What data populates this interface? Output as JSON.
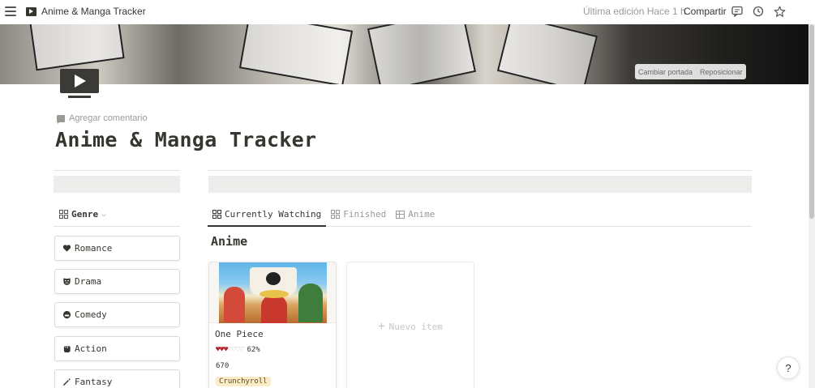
{
  "topbar": {
    "breadcrumb": "Anime & Manga Tracker",
    "last_edited": "Última edición Hace 1 h",
    "share_label": "Compartir",
    "icons": [
      "menu-icon",
      "comment-icon",
      "history-icon",
      "star-icon"
    ]
  },
  "cover": {
    "change_cover": "Cambiar portada",
    "reposition": "Reposicionar"
  },
  "page": {
    "icon": "tv-icon",
    "add_comment": "Agregar comentario",
    "title": "Anime & Manga Tracker"
  },
  "genre_filter": {
    "label": "Genre",
    "items": [
      {
        "label": "Romance",
        "icon": "heart-icon"
      },
      {
        "label": "Drama",
        "icon": "mask-icon"
      },
      {
        "label": "Comedy",
        "icon": "smile-icon"
      },
      {
        "label": "Action",
        "icon": "fist-icon"
      },
      {
        "label": "Fantasy",
        "icon": "magic-wand-icon"
      }
    ]
  },
  "tabs": [
    {
      "label": "Currently Watching",
      "icon": "gallery-icon",
      "active": true
    },
    {
      "label": "Finished",
      "icon": "gallery-icon",
      "active": false
    },
    {
      "label": "Anime",
      "icon": "table-icon",
      "active": false
    }
  ],
  "section": {
    "title": "Anime"
  },
  "cards": [
    {
      "title": "One Piece",
      "rating_hearts": 3,
      "rating_total": 7,
      "progress": "62%",
      "episodes": "670",
      "tag": "Crunchyroll"
    }
  ],
  "new_item": "Nuevo item",
  "help": "?",
  "colors": {
    "text": "#37352f",
    "muted": "#9b9a97",
    "heart": "#b3282d",
    "tag_bg": "#fbecc8"
  }
}
